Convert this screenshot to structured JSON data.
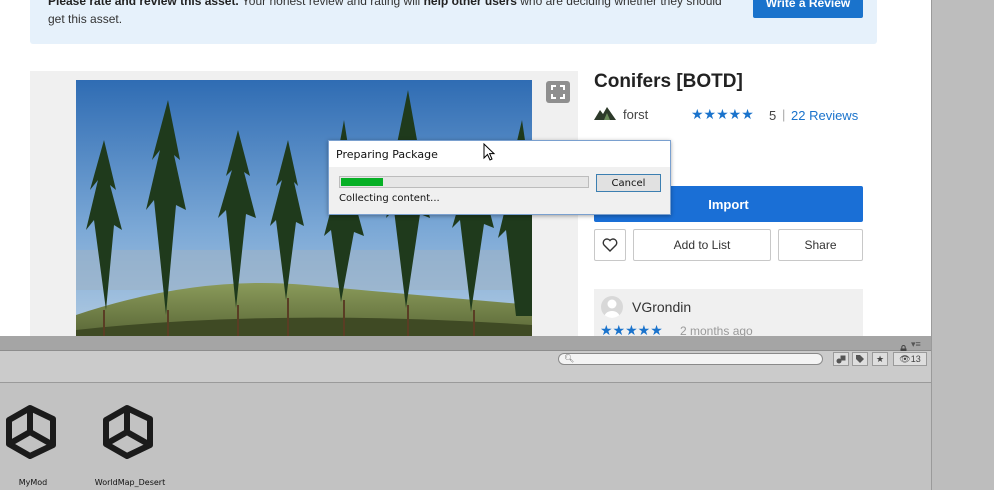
{
  "banner": {
    "lead": "Please rate and review this asset.",
    "middle": " Your honest review and rating will ",
    "bold2": "help other users",
    "tail": " who are deciding whether they should get this asset.",
    "write_review_label": "Write a Review"
  },
  "asset": {
    "title": "Conifers [BOTD]",
    "publisher": "forst",
    "stars": "★★★★★",
    "rating": "5",
    "separator": "|",
    "reviews_link": "22 Reviews",
    "import_label": "Import",
    "add_to_list_label": "Add to List",
    "share_label": "Share"
  },
  "review": {
    "reviewer": "VGrondin",
    "stars": "★★★★★",
    "date": "2 months ago"
  },
  "dialog": {
    "title": "Preparing Package",
    "status": "Collecting content...",
    "cancel_label": "Cancel",
    "progress": 0.17
  },
  "project_panel": {
    "search_placeholder": "",
    "hidden_count": "13",
    "assets": [
      {
        "name": "MyMod",
        "icon": "unity-logo-icon"
      },
      {
        "name": "WorldMap_Desert",
        "icon": "unity-logo-icon"
      }
    ]
  },
  "colors": {
    "accent": "#1a73cc",
    "banner_bg": "#e6f1fb",
    "progress_green": "#06b025",
    "panel_bg": "#c2c2c2"
  }
}
